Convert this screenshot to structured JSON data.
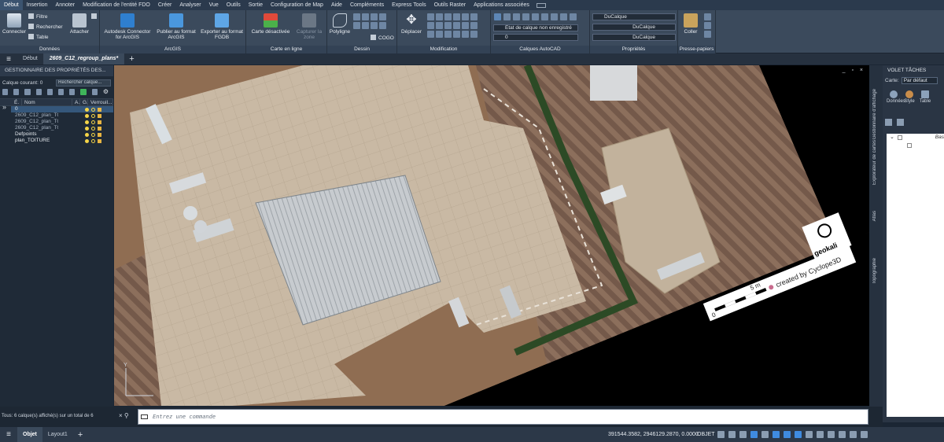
{
  "menu": [
    {
      "label": "Début",
      "active": true
    },
    {
      "label": "Insertion"
    },
    {
      "label": "Annoter"
    },
    {
      "label": "Modification de l'entité FDO"
    },
    {
      "label": "Créer"
    },
    {
      "label": "Analyser"
    },
    {
      "label": "Vue"
    },
    {
      "label": "Outils"
    },
    {
      "label": "Sortie"
    },
    {
      "label": "Configuration de Map"
    },
    {
      "label": "Aide"
    },
    {
      "label": "Compléments"
    },
    {
      "label": "Express Tools"
    },
    {
      "label": "Outils Raster"
    },
    {
      "label": "Applications associées"
    }
  ],
  "ribbon": {
    "donnees": {
      "title": "Données",
      "connecter": "Connecter",
      "filtre": "Filtre",
      "rechercher": "Rechercher",
      "table": "Table",
      "attacher": "Attacher"
    },
    "arcgis": {
      "title": "ArcGIS",
      "connector": "Autodesk Connector for ArcGIS",
      "publier": "Publier au format ArcGIS",
      "exporter": "Exporter au format FGDB"
    },
    "carte_en_ligne": {
      "title": "Carte en ligne",
      "carte": "Carte désactivée",
      "capturer": "Capturer la zone"
    },
    "dessin": {
      "title": "Dessin",
      "polyligne": "Polyligne",
      "cogo": "COGO"
    },
    "modification": {
      "title": "Modification",
      "deplacer": "Déplacer"
    },
    "calques": {
      "title": "Calques AutoCAD",
      "etat": "État de calque non enregistré",
      "current": "0"
    },
    "proprietes": {
      "title": "Propriétés",
      "couleur": "DuCalque",
      "ligne1": "DuCalque",
      "ligne2": "DuCalque"
    },
    "presse": {
      "title": "Presse-papiers",
      "coller": "Coller"
    }
  },
  "doc_tabs": {
    "start": "Début",
    "active": "2609_C12_regroup_plans*"
  },
  "layer_panel": {
    "title": "GESTIONNAIRE DES PROPRIÉTÉS DES...",
    "current_label": "Calque courant: 0",
    "search_placeholder": "Rechercher calque...",
    "columns": {
      "etat": "É.",
      "nom": "Nom",
      "a": "A.",
      "g": "G.",
      "verrouille": "Verrouil..."
    },
    "layers": [
      {
        "name": "0",
        "selected": true,
        "bright": true
      },
      {
        "name": "2609_C12_plan_TO...",
        "bright": false
      },
      {
        "name": "2609_C12_plan_TO...",
        "bright": false
      },
      {
        "name": "2609_C12_plan_TO...",
        "bright": false
      },
      {
        "name": "Defpoints",
        "bright": true
      },
      {
        "name": "plan_TOITURE",
        "bright": true
      }
    ],
    "side_label": "Gestionnaire des propriétés des calques"
  },
  "map": {
    "logo_text": "geokali",
    "credit_text": "created by Cyclope3D",
    "scale_zero": "0",
    "scale_end": "5 m"
  },
  "task_panel": {
    "title": "VOLET TÂCHES",
    "carte_label": "Carte:",
    "carte_value": "Par défaut",
    "tabs": [
      "Données",
      "Style",
      "Table"
    ],
    "tree_item": "Bas",
    "side_tabs": [
      "Gestionnaire d'affichage",
      "Explorateur de cartes",
      "Atlas",
      "Topographie"
    ]
  },
  "command": {
    "status": "Tous: 6 calque(s) affiché(s) sur un total de 6",
    "placeholder": "Entrez une commande"
  },
  "status_bar": {
    "model_tab": "Objet",
    "layout_tab": "Layout1",
    "coords": "391544.3582, 2946129.2870, 0.0000",
    "mode": "OBJET"
  },
  "colors": {
    "accent": "#3f8be0",
    "ribbon": "#3b4a5c",
    "dark": "#1b2634"
  }
}
